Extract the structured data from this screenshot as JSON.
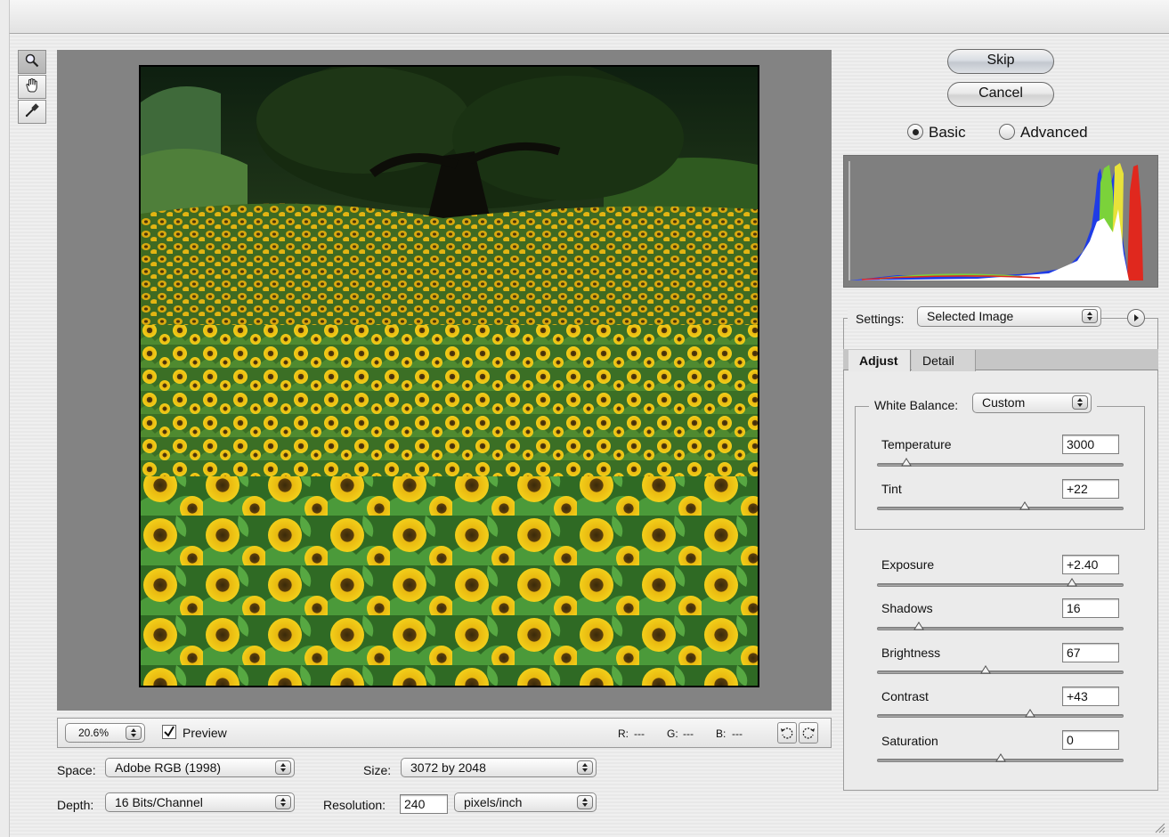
{
  "toolbar_tools": [
    {
      "name": "zoom-tool",
      "icon": "magnifier-icon"
    },
    {
      "name": "hand-tool",
      "icon": "hand-icon"
    },
    {
      "name": "white-balance-tool",
      "icon": "eyedropper-icon"
    }
  ],
  "buttons": {
    "skip": "Skip",
    "cancel": "Cancel"
  },
  "mode": {
    "basic": "Basic",
    "advanced": "Advanced",
    "selected": "Basic"
  },
  "statusbar": {
    "zoom": "20.6%",
    "preview_label": "Preview",
    "preview_checked": true,
    "r_label": "R:",
    "r_value": "---",
    "g_label": "G:",
    "g_value": "---",
    "b_label": "B:",
    "b_value": "---"
  },
  "workflow": {
    "space_label": "Space:",
    "space_value": "Adobe RGB (1998)",
    "depth_label": "Depth:",
    "depth_value": "16 Bits/Channel",
    "size_label": "Size:",
    "size_value": "3072 by 2048",
    "resolution_label": "Resolution:",
    "resolution_value": "240",
    "resolution_unit": "pixels/inch"
  },
  "settings": {
    "label": "Settings:",
    "value": "Selected Image"
  },
  "tabs": [
    {
      "label": "Adjust",
      "active": true
    },
    {
      "label": "Detail",
      "active": false
    }
  ],
  "white_balance": {
    "label": "White Balance:",
    "value": "Custom"
  },
  "sliders": [
    {
      "key": "temperature",
      "label": "Temperature",
      "value": "3000",
      "position": 0.12
    },
    {
      "key": "tint",
      "label": "Tint",
      "value": "+22",
      "position": 0.6
    },
    {
      "key": "exposure",
      "label": "Exposure",
      "value": "+2.40",
      "position": 0.79
    },
    {
      "key": "shadows",
      "label": "Shadows",
      "value": "16",
      "position": 0.17
    },
    {
      "key": "brightness",
      "label": "Brightness",
      "value": "67",
      "position": 0.44
    },
    {
      "key": "contrast",
      "label": "Contrast",
      "value": "+43",
      "position": 0.62
    },
    {
      "key": "saturation",
      "label": "Saturation",
      "value": "0",
      "position": 0.5
    }
  ],
  "colors": {
    "canvas_gray": "#838383",
    "histogram_bg": "#7f7f7f",
    "histogram_red": "#e0281e",
    "histogram_green": "#7bd23a",
    "histogram_blue": "#1f3ce6",
    "histogram_yellow": "#e8e23a"
  }
}
